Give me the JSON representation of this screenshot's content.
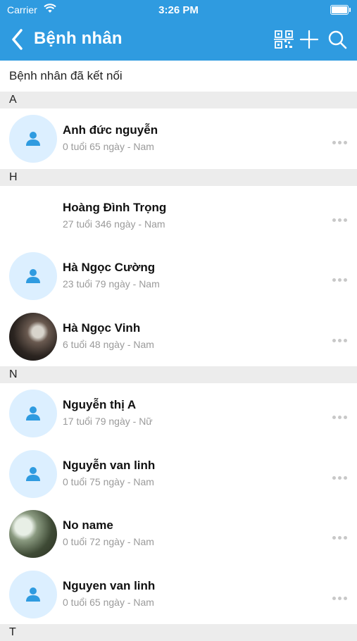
{
  "status_bar": {
    "carrier": "Carrier",
    "time": "3:26 PM"
  },
  "nav": {
    "title": "Bệnh nhân"
  },
  "subtitle": "Bệnh nhân đã kết nối",
  "sections": [
    {
      "letter": "A",
      "patients": [
        {
          "name": "Anh đức nguyễn",
          "age": "0 tuổi 65 ngày -",
          "gender": "Nam",
          "avatar": "default"
        }
      ]
    },
    {
      "letter": "H",
      "patients": [
        {
          "name": "Hoàng Đình Trọng",
          "age": "27 tuổi 346 ngày -",
          "gender": "Nam",
          "avatar": "none"
        },
        {
          "name": "Hà Ngọc Cường",
          "age": "23 tuổi 79 ngày -",
          "gender": "Nam",
          "avatar": "default"
        },
        {
          "name": "Hà Ngọc Vinh",
          "age": "6 tuổi 48 ngày -",
          "gender": "Nam",
          "avatar": "photo1"
        }
      ]
    },
    {
      "letter": "N",
      "patients": [
        {
          "name": "Nguyễn thị A",
          "age": "17 tuổi 79 ngày -",
          "gender": "Nữ",
          "avatar": "default"
        },
        {
          "name": "Nguyễn van linh",
          "age": "0 tuổi 75 ngày -",
          "gender": "Nam",
          "avatar": "default"
        },
        {
          "name": "No name",
          "age": "0 tuổi 72 ngày -",
          "gender": "Nam",
          "avatar": "photo2"
        },
        {
          "name": "Nguyen van linh",
          "age": "0 tuổi 65 ngày -",
          "gender": "Nam",
          "avatar": "default"
        }
      ]
    },
    {
      "letter": "T",
      "patients": []
    }
  ],
  "colors": {
    "accent": "#2f9be0",
    "avatar_bg": "#dcefff",
    "section_bg": "#ececec",
    "meta_text": "#9a9a9a"
  }
}
